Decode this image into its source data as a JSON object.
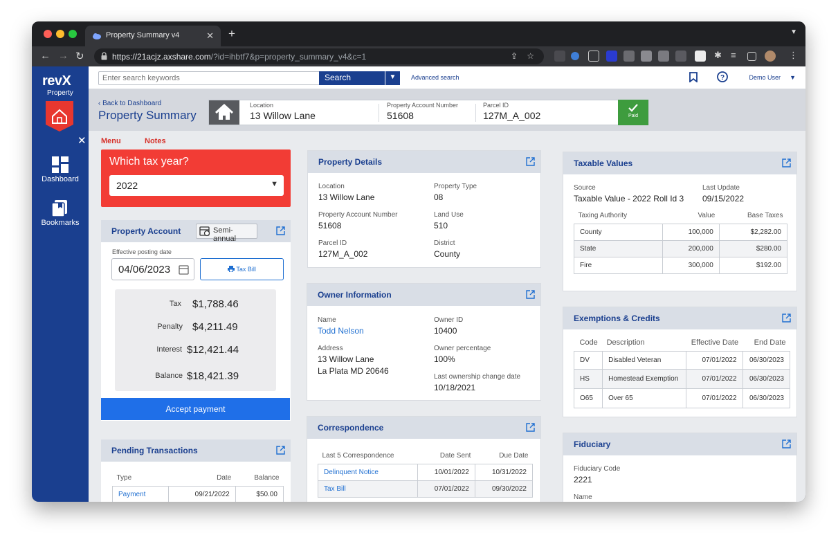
{
  "browser": {
    "tab_title": "Property Summary v4",
    "new_tab": "+",
    "url_host": "https://21acjz.axshare.com",
    "url_path": "/?id=ihbtf7&p=property_summary_v4&c=1"
  },
  "sidebar": {
    "logo": "revX",
    "logo_sub": "Property",
    "close": "✕",
    "items": [
      {
        "label": "Dashboard"
      },
      {
        "label": "Bookmarks"
      }
    ]
  },
  "topbar": {
    "search_placeholder": "Enter search keywords",
    "search_label": "Search",
    "advanced_search": "Advanced search",
    "user": "Demo User"
  },
  "header": {
    "back_link": "Back to Dashboard",
    "title": "Property Summary",
    "location_label": "Location",
    "location_value": "13 Willow Lane",
    "account_label": "Property Account Number",
    "account_value": "51608",
    "parcel_label": "Parcel ID",
    "parcel_value": "127M_A_002",
    "paid_label": "Paid"
  },
  "tabs": {
    "menu": "Menu",
    "notes": "Notes"
  },
  "tax_year": {
    "title": "Which tax year?",
    "selected": "2022"
  },
  "property_account": {
    "title": "Property Account",
    "schedule": "Semi-annual",
    "posting_label": "Effective posting date",
    "posting_date": "04/06/2023",
    "tax_bill_label": "Tax Bill",
    "lines": [
      {
        "label": "Tax",
        "value": "$1,788.46"
      },
      {
        "label": "Penalty",
        "value": "$4,211.49"
      },
      {
        "label": "Interest",
        "value": "$12,421.44"
      },
      {
        "label": "Balance",
        "value": "$18,421.39"
      }
    ],
    "accept_label": "Accept payment"
  },
  "pending": {
    "title": "Pending Transactions",
    "headers": [
      "Type",
      "Date",
      "Balance"
    ],
    "rows": [
      {
        "type": "Payment",
        "date": "09/21/2022",
        "balance": "$50.00"
      }
    ]
  },
  "property_details": {
    "title": "Property Details",
    "fields": [
      {
        "label": "Location",
        "value": "13 Willow Lane"
      },
      {
        "label": "Property Type",
        "value": "08"
      },
      {
        "label": "Property Account Number",
        "value": "51608"
      },
      {
        "label": "Land Use",
        "value": "510"
      },
      {
        "label": "Parcel ID",
        "value": "127M_A_002"
      },
      {
        "label": "District",
        "value": "County"
      }
    ]
  },
  "owner": {
    "title": "Owner Information",
    "name_label": "Name",
    "name_value": "Todd Nelson",
    "owner_id_label": "Owner ID",
    "owner_id_value": "10400",
    "address_label": "Address",
    "address_line1": "13 Willow Lane",
    "address_line2": "La Plata MD 20646",
    "percentage_label": "Owner percentage",
    "percentage_value": "100%",
    "change_label": "Last ownership change date",
    "change_value": "10/18/2021"
  },
  "correspondence": {
    "title": "Correspondence",
    "headers": [
      "Last 5 Correspondence",
      "Date Sent",
      "Due Date"
    ],
    "rows": [
      {
        "name": "Delinquent Notice",
        "sent": "10/01/2022",
        "due": "10/31/2022"
      },
      {
        "name": "Tax Bill",
        "sent": "07/01/2022",
        "due": "09/30/2022"
      }
    ]
  },
  "taxable": {
    "title": "Taxable Values",
    "source_label": "Source",
    "source_value": "Taxable Value - 2022 Roll Id 3",
    "update_label": "Last Update",
    "update_value": "09/15/2022",
    "headers": [
      "Taxing Authority",
      "Value",
      "Base Taxes"
    ],
    "rows": [
      {
        "authority": "County",
        "value": "100,000",
        "base": "$2,282.00"
      },
      {
        "authority": "State",
        "value": "200,000",
        "base": "$280.00"
      },
      {
        "authority": "Fire",
        "value": "300,000",
        "base": "$192.00"
      }
    ]
  },
  "exemptions": {
    "title": "Exemptions & Credits",
    "headers": [
      "Code",
      "Description",
      "Effective Date",
      "End Date"
    ],
    "rows": [
      {
        "code": "DV",
        "desc": "Disabled Veteran",
        "eff": "07/01/2022",
        "end": "06/30/2023"
      },
      {
        "code": "HS",
        "desc": "Homestead Exemption",
        "eff": "07/01/2022",
        "end": "06/30/2023"
      },
      {
        "code": "O65",
        "desc": "Over 65",
        "eff": "07/01/2022",
        "end": "06/30/2023"
      }
    ]
  },
  "fiduciary": {
    "title": "Fiduciary",
    "code_label": "Fiduciary Code",
    "code_value": "2221",
    "name_label": "Name"
  },
  "colors": {
    "brand": "#1a3f8f",
    "accent_red": "#f23c35",
    "paid_green": "#3e9c3e",
    "action_blue": "#1f6fe8"
  },
  "icons": [
    "home-icon",
    "calendar-icon",
    "printer-icon",
    "expand-icon",
    "bookmark-icon",
    "help-icon",
    "dashboard-icon",
    "bookmarks-icon",
    "check-icon"
  ]
}
